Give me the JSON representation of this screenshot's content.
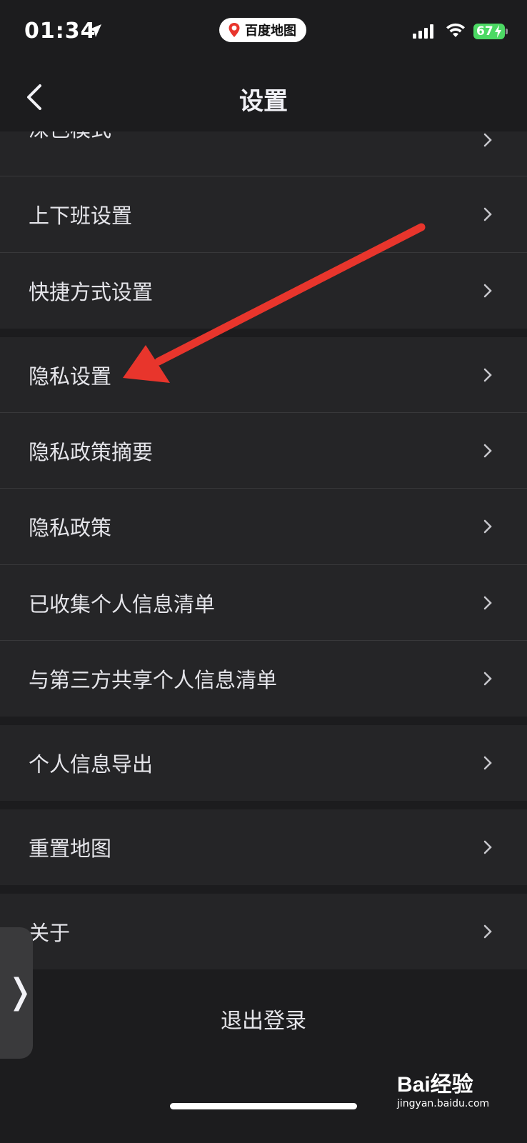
{
  "status_bar": {
    "time": "01:34",
    "app_pill": "百度地图",
    "battery": "67",
    "icons": [
      "location-arrow-icon",
      "baidu-map-pin-icon",
      "signal-icon",
      "wifi-icon",
      "battery-icon"
    ]
  },
  "nav": {
    "title": "设置",
    "back_icon": "chevron-left-icon"
  },
  "list": {
    "partial_item": "深色模式",
    "items": [
      "上下班设置",
      "快捷方式设置",
      "隐私设置",
      "隐私政策摘要",
      "隐私政策",
      "已收集个人信息清单",
      "与第三方共享个人信息清单",
      "个人信息导出",
      "重置地图",
      "关于"
    ],
    "chevron_icon": "chevron-right-icon"
  },
  "logout_label": "退出登录",
  "side_handle_glyph": "❭",
  "annotation": {
    "color": "#e8352c",
    "icon": "red-arrow-pointing-to-privacy-settings"
  },
  "watermark": {
    "brand": "Bai经验",
    "url": "jingyan.baidu.com"
  },
  "colors": {
    "background": "#1c1c1e",
    "row": "#252527",
    "separator": "#38383a",
    "battery": "#4cd964"
  }
}
